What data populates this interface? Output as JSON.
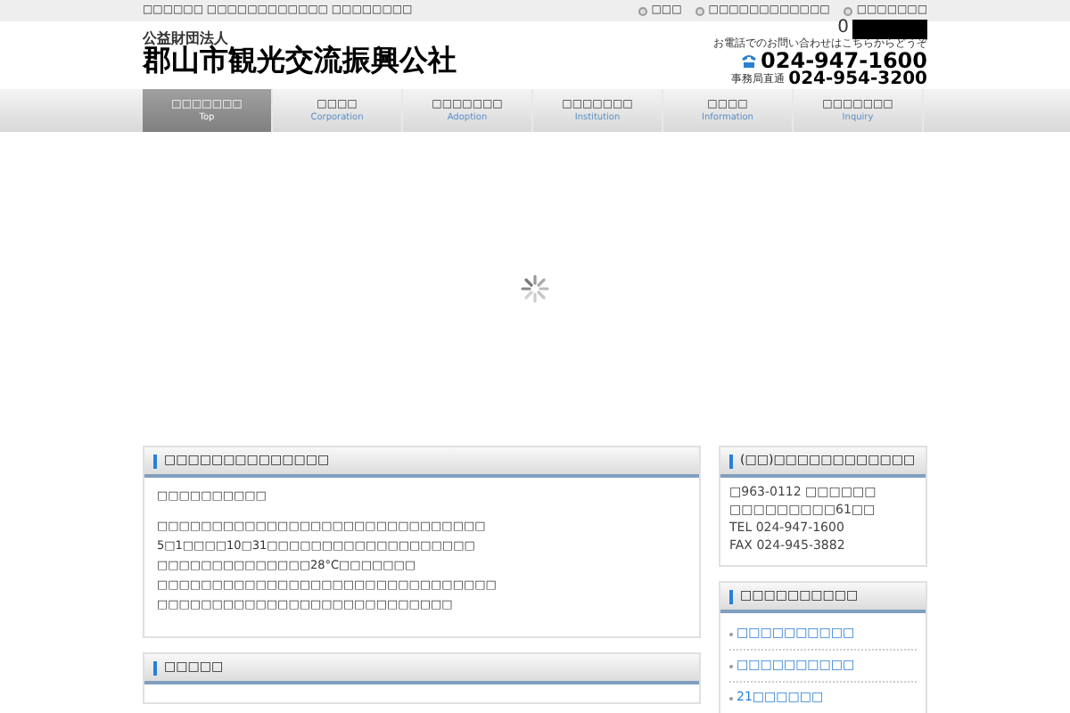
{
  "top_bar": {
    "tagline": "□□□□□□ □□□□□□□□□□□□ □□□□□□□□",
    "links": [
      "□□□",
      "□□□□□□□□□□□□",
      "□□□□□□□"
    ]
  },
  "header": {
    "org_type": "公益財団法人",
    "org_name": "郡山市観光交流振興公社",
    "counter": "0",
    "phone_note": "お電話でのお問い合わせはこちらからどうぞ",
    "phone": "024-947-1600",
    "direct_label": "事務局直通",
    "direct_phone": "024-954-3200"
  },
  "nav": [
    {
      "label": "□□□□□□□",
      "sub": "Top",
      "selected": true
    },
    {
      "label": "□□□□",
      "sub": "Corporation",
      "selected": false
    },
    {
      "label": "□□□□□□□",
      "sub": "Adoption",
      "selected": false
    },
    {
      "label": "□□□□□□□",
      "sub": "Institution",
      "selected": false
    },
    {
      "label": "□□□□",
      "sub": "Information",
      "selected": false
    },
    {
      "label": "□□□□□□□",
      "sub": "Inquiry",
      "selected": false
    }
  ],
  "main_panels": [
    {
      "title": "□□□□□□□□□□□□□□",
      "paragraphs": [
        [
          "□□□□□□□□□□"
        ],
        [
          "□□□□□□□□□□□□□□□□□□□□□□□□□□□□□□",
          "5□1□□□□10□31□□□□□□□□□□□□□□□□□□□",
          "□□□□□□□□□□□□□□28°C□□□□□□□",
          "□□□□□□□□□□□□□□□□□□□□□□□□□□□□□□□",
          "□□□□□□□□□□□□□□□□□□□□□□□□□□□"
        ]
      ]
    },
    {
      "title": "□□□□□"
    }
  ],
  "side_panels": [
    {
      "title": "(□□)□□□□□□□□□□□□",
      "lines": [
        "□963-0112 □□□□□□",
        "□□□□□□□□□61□□",
        "TEL 024-947-1600",
        "FAX 024-945-3882"
      ]
    },
    {
      "title": "□□□□□□□□□□",
      "links": [
        "□□□□□□□□□□",
        "□□□□□□□□□□",
        "21□□□□□□"
      ]
    }
  ]
}
